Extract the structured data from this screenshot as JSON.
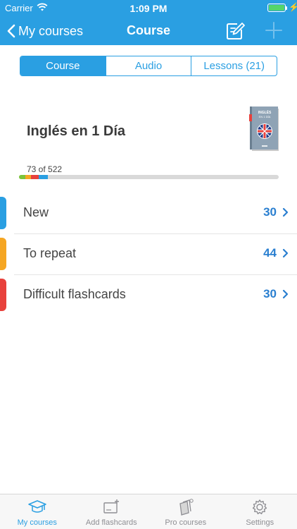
{
  "status": {
    "carrier": "Carrier",
    "time": "1:09 PM"
  },
  "nav": {
    "back_label": "My courses",
    "title": "Course"
  },
  "segments": [
    {
      "label": "Course",
      "active": true
    },
    {
      "label": "Audio",
      "active": false
    },
    {
      "label": "Lessons (21)",
      "active": false
    }
  ],
  "course": {
    "title": "Inglés en 1 Día",
    "cover_text_1": "INGLÉS",
    "cover_text_2": "EN 1 DÍA",
    "progress_label": "73 of 522",
    "progress_segments": [
      {
        "color": "#7cc43a",
        "fraction": 0.025
      },
      {
        "color": "#f5a623",
        "fraction": 0.02
      },
      {
        "color": "#e8413c",
        "fraction": 0.03
      },
      {
        "color": "#2a9fe2",
        "fraction": 0.035
      }
    ]
  },
  "rows": [
    {
      "label": "New",
      "count": "30",
      "color": "#2a9fe2"
    },
    {
      "label": "To repeat",
      "count": "44",
      "color": "#f5a623"
    },
    {
      "label": "Difficult flashcards",
      "count": "30",
      "color": "#e8413c"
    }
  ],
  "tabs": [
    {
      "label": "My courses",
      "icon": "graduation-cap-icon",
      "active": true
    },
    {
      "label": "Add flashcards",
      "icon": "add-flashcard-icon",
      "active": false
    },
    {
      "label": "Pro courses",
      "icon": "pro-courses-icon",
      "active": false
    },
    {
      "label": "Settings",
      "icon": "gear-icon",
      "active": false
    }
  ],
  "colors": {
    "accent": "#2a9fe2",
    "count_text": "#2a7fd0"
  }
}
